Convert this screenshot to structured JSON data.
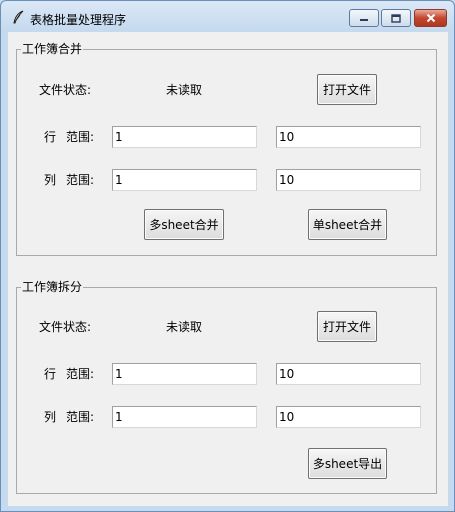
{
  "window": {
    "title": "表格批量处理程序",
    "icon": "feather-icon"
  },
  "merge": {
    "legend": "工作簿合并",
    "status_label": "文件状态:",
    "status_value": "未读取",
    "open_button": "打开文件",
    "row_label": "行  范围:",
    "row_start": "1",
    "row_end": "10",
    "col_label": "列  范围:",
    "col_start": "1",
    "col_end": "10",
    "multi_button": "多sheet合并",
    "single_button": "单sheet合并"
  },
  "split": {
    "legend": "工作簿拆分",
    "status_label": "文件状态:",
    "status_value": "未读取",
    "open_button": "打开文件",
    "row_label": "行  范围:",
    "row_start": "1",
    "row_end": "10",
    "col_label": "列  范围:",
    "col_start": "1",
    "col_end": "10",
    "export_button": "多sheet导出"
  }
}
